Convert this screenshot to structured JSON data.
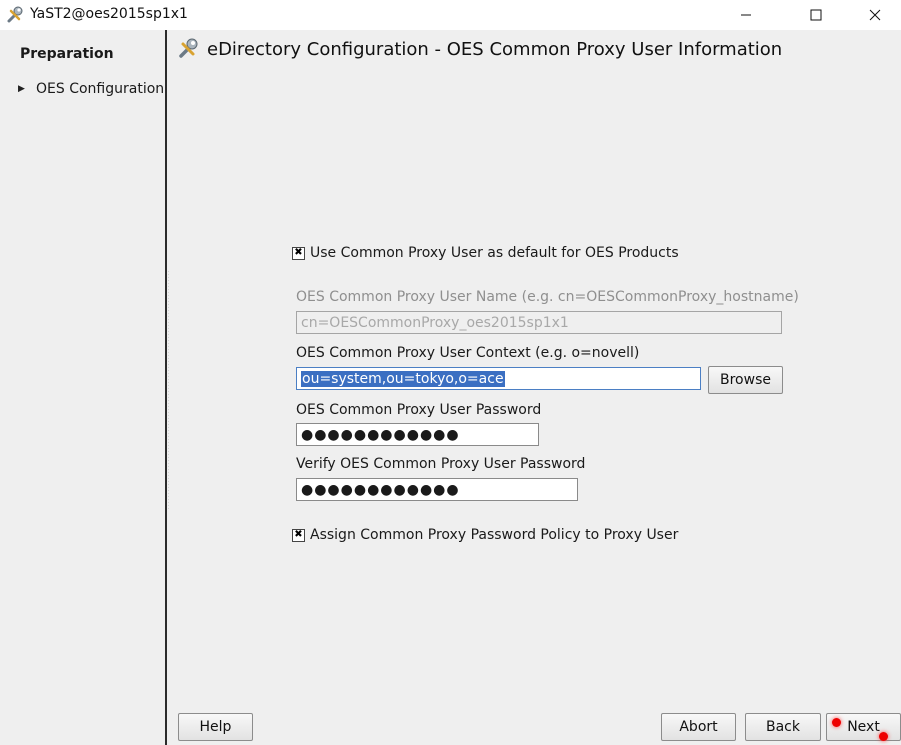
{
  "window": {
    "title": "YaST2@oes2015sp1x1",
    "icon": "wrench-screwdriver-icon"
  },
  "sidebar": {
    "heading": "Preparation",
    "items": [
      {
        "label": "OES Configuration",
        "icon": "triangle-right-icon"
      }
    ]
  },
  "header": {
    "title": "eDirectory Configuration - OES Common Proxy User Information",
    "icon": "wrench-screwdriver-icon"
  },
  "form": {
    "use_common_proxy": {
      "label": "Use Common Proxy User as default for OES Products",
      "checked": true
    },
    "proxy_user_name": {
      "label": "OES Common Proxy User Name (e.g. cn=OESCommonProxy_hostname)",
      "value": "cn=OESCommonProxy_oes2015sp1x1",
      "disabled": true
    },
    "proxy_user_context": {
      "label": "OES Common Proxy User Context (e.g. o=novell)",
      "value": "ou=system,ou=tokyo,o=ace",
      "browse_label": "Browse"
    },
    "proxy_user_password": {
      "label": "OES Common Proxy User Password",
      "masked_value": "●●●●●●●●●●●●"
    },
    "verify_password": {
      "label": "Verify OES Common Proxy User Password",
      "masked_value": "●●●●●●●●●●●●"
    },
    "assign_policy": {
      "label": "Assign Common Proxy Password Policy to Proxy User",
      "checked": true
    }
  },
  "footer": {
    "help": "Help",
    "abort": "Abort",
    "back": "Back",
    "next": "Next"
  }
}
